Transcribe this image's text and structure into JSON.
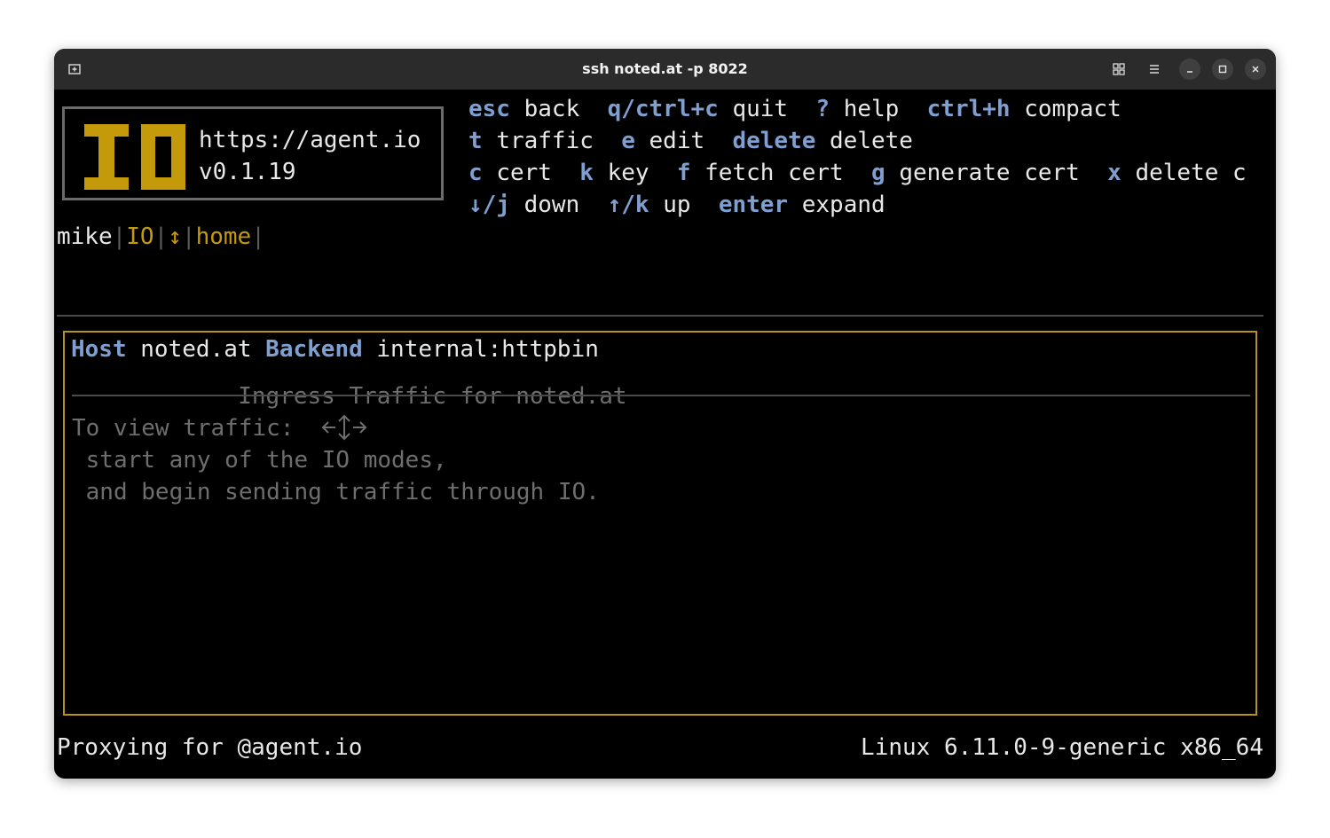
{
  "window": {
    "title": "ssh noted.at -p 8022",
    "icons": [
      "new-tab-icon",
      "grid-icon",
      "menu-icon",
      "minimize-icon",
      "maximize-icon",
      "close-icon"
    ]
  },
  "logo": {
    "mark": "IO",
    "url": "https://agent.io",
    "version": "v0.1.19"
  },
  "keybindings": [
    [
      {
        "key": "esc",
        "action": "back"
      },
      {
        "key": "q/ctrl+c",
        "action": "quit"
      },
      {
        "key": "?",
        "action": "help"
      },
      {
        "key": "ctrl+h",
        "action": "compact"
      }
    ],
    [
      {
        "key": "t",
        "action": "traffic"
      },
      {
        "key": "e",
        "action": "edit"
      },
      {
        "key": "delete",
        "action": "delete"
      }
    ],
    [
      {
        "key": "c",
        "action": "cert"
      },
      {
        "key": "k",
        "action": "key"
      },
      {
        "key": "f",
        "action": "fetch cert"
      },
      {
        "key": "g",
        "action": "generate cert"
      },
      {
        "key": "x",
        "action": "delete c"
      }
    ],
    [
      {
        "key": "↓/j",
        "action": "down"
      },
      {
        "key": "↑/k",
        "action": "up"
      },
      {
        "key": "enter",
        "action": "expand"
      }
    ]
  ],
  "breadcrumb": {
    "user": "mike",
    "separator": "|",
    "app": "IO",
    "mode_icon": "up-down-arrow-icon",
    "mode_glyph": "↕",
    "page": "home"
  },
  "host_info": {
    "host_label": "Host",
    "host_value": "noted.at",
    "backend_label": "Backend",
    "backend_value": "internal:httpbin"
  },
  "traffic_panel": {
    "icon": "ingress-arrows-icon",
    "title": "Ingress Traffic for noted.at",
    "lines": [
      "To view traffic:",
      " start any of the IO modes,",
      " and begin sending traffic through IO."
    ]
  },
  "status_bar": {
    "left": "Proxying for @agent.io",
    "right": "Linux 6.11.0-9-generic x86_64"
  },
  "colors": {
    "key": "#7f9fd1",
    "accent": "#c49a0a",
    "panel_border": "#b8911c",
    "text": "#e8e8e8",
    "muted": "#6e6e6e",
    "background": "#000000",
    "titlebar": "#2b2b2b"
  }
}
